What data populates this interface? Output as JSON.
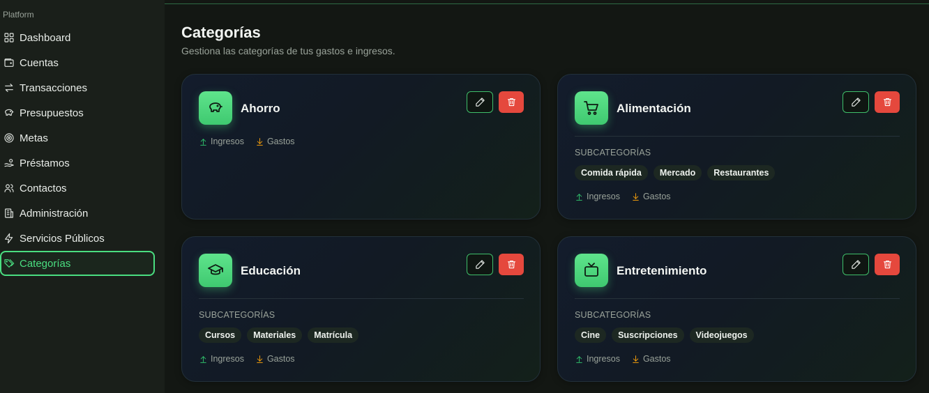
{
  "sidebar": {
    "group_label": "Platform",
    "items": [
      {
        "label": "Dashboard",
        "icon": "dashboard-icon"
      },
      {
        "label": "Cuentas",
        "icon": "wallet-icon"
      },
      {
        "label": "Transacciones",
        "icon": "transfer-icon"
      },
      {
        "label": "Presupuestos",
        "icon": "piggy-bank-icon"
      },
      {
        "label": "Metas",
        "icon": "target-icon"
      },
      {
        "label": "Préstamos",
        "icon": "hand-coins-icon"
      },
      {
        "label": "Contactos",
        "icon": "users-icon"
      },
      {
        "label": "Administración",
        "icon": "building-icon"
      },
      {
        "label": "Servicios Públicos",
        "icon": "zap-icon"
      },
      {
        "label": "Categorías",
        "icon": "tags-icon",
        "active": true
      }
    ]
  },
  "page": {
    "title": "Categorías",
    "subtitle": "Gestiona las categorías de tus gastos e ingresos."
  },
  "common": {
    "subcategories_label": "SUBCATEGORÍAS",
    "income_label": "Ingresos",
    "expense_label": "Gastos"
  },
  "cards": [
    {
      "title": "Ahorro",
      "icon": "piggy-bank-icon",
      "subcategories": []
    },
    {
      "title": "Alimentación",
      "icon": "shopping-cart-icon",
      "subcategories": [
        "Comida rápida",
        "Mercado",
        "Restaurantes"
      ]
    },
    {
      "title": "Educación",
      "icon": "graduation-cap-icon",
      "subcategories": [
        "Cursos",
        "Materiales",
        "Matrícula"
      ]
    },
    {
      "title": "Entretenimiento",
      "icon": "tv-icon",
      "subcategories": [
        "Cine",
        "Suscripciones",
        "Videojuegos"
      ]
    }
  ],
  "colors": {
    "accent": "#4ade80",
    "delete": "#e5483d",
    "income_arrow": "#2fbf6a",
    "expense_arrow": "#f59e0b"
  }
}
